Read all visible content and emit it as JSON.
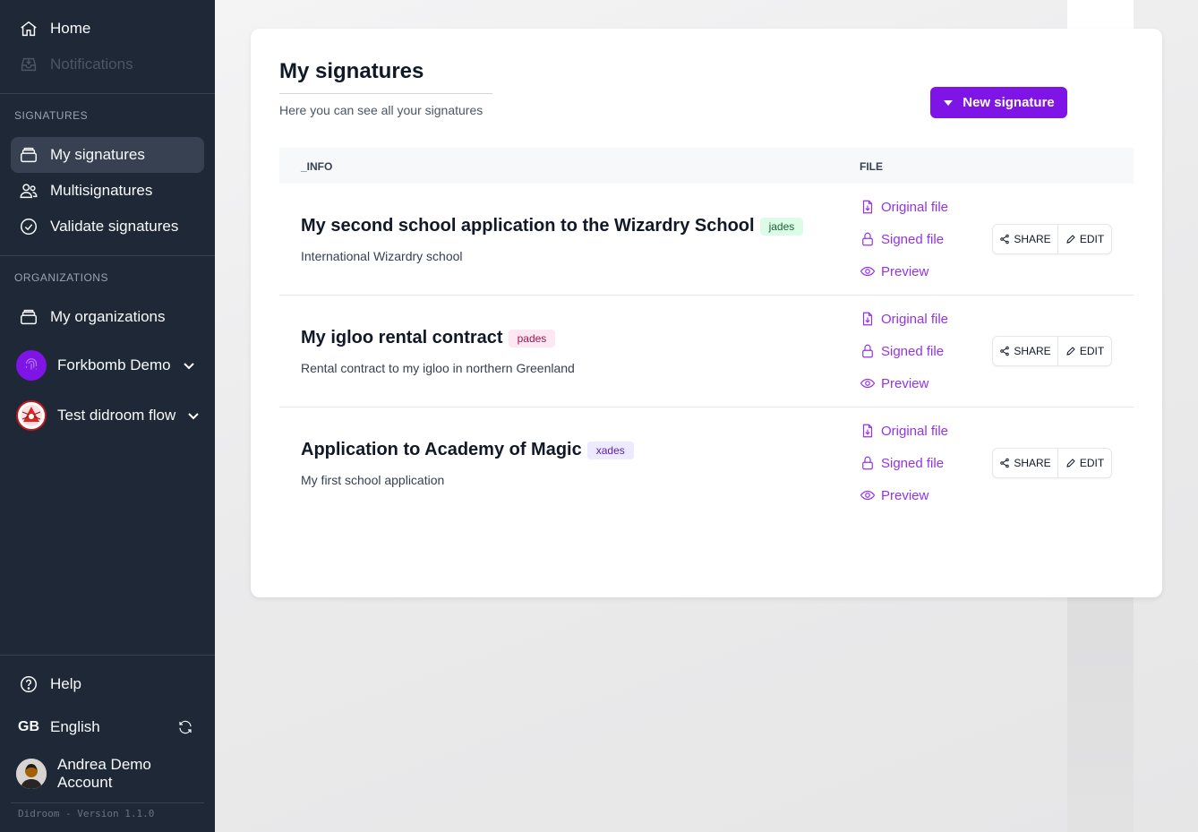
{
  "sidebar": {
    "nav": [
      {
        "label": "Home",
        "icon": "home-icon"
      },
      {
        "label": "Notifications",
        "icon": "inbox-icon"
      }
    ],
    "signatures_header": "SIGNATURES",
    "signatures_items": [
      {
        "label": "My signatures",
        "icon": "stack-icon"
      },
      {
        "label": "Multisignatures",
        "icon": "users-icon"
      },
      {
        "label": "Validate signatures",
        "icon": "check-circle-icon"
      }
    ],
    "organizations_header": "ORGANIZATIONS",
    "organizations_items": [
      {
        "label": "My organizations",
        "icon": "stack-icon"
      },
      {
        "label": "Forkbomb Demo",
        "icon": "fingerprint-icon"
      },
      {
        "label": "Test didroom flow",
        "icon": "org-logo-icon"
      }
    ],
    "bottom": {
      "help": "Help",
      "language_code": "GB",
      "language": "English",
      "account": "Andrea Demo Account"
    },
    "version": "Didroom - Version 1.1.0"
  },
  "main": {
    "title": "My signatures",
    "subtitle": "Here you can see all your signatures",
    "new_button": "New signature",
    "table": {
      "col_info": "_INFO",
      "col_file": "FILE",
      "file_links": {
        "original": "Original file",
        "signed": "Signed file",
        "preview": "Preview"
      },
      "actions": {
        "share": "SHARE",
        "edit": "EDIT"
      },
      "rows": [
        {
          "title": "My second school application to the Wizardry School",
          "badge": "jades",
          "description": "International Wizardry school"
        },
        {
          "title": "My igloo rental contract",
          "badge": "pades",
          "description": "Rental contract to my igloo in northern Greenland"
        },
        {
          "title": "Application to Academy of Magic",
          "badge": "xades",
          "description": "My first school application"
        }
      ]
    }
  },
  "colors": {
    "sidebar_bg": "#1f2836",
    "accent": "#7e14e5",
    "link": "#9333ea"
  }
}
